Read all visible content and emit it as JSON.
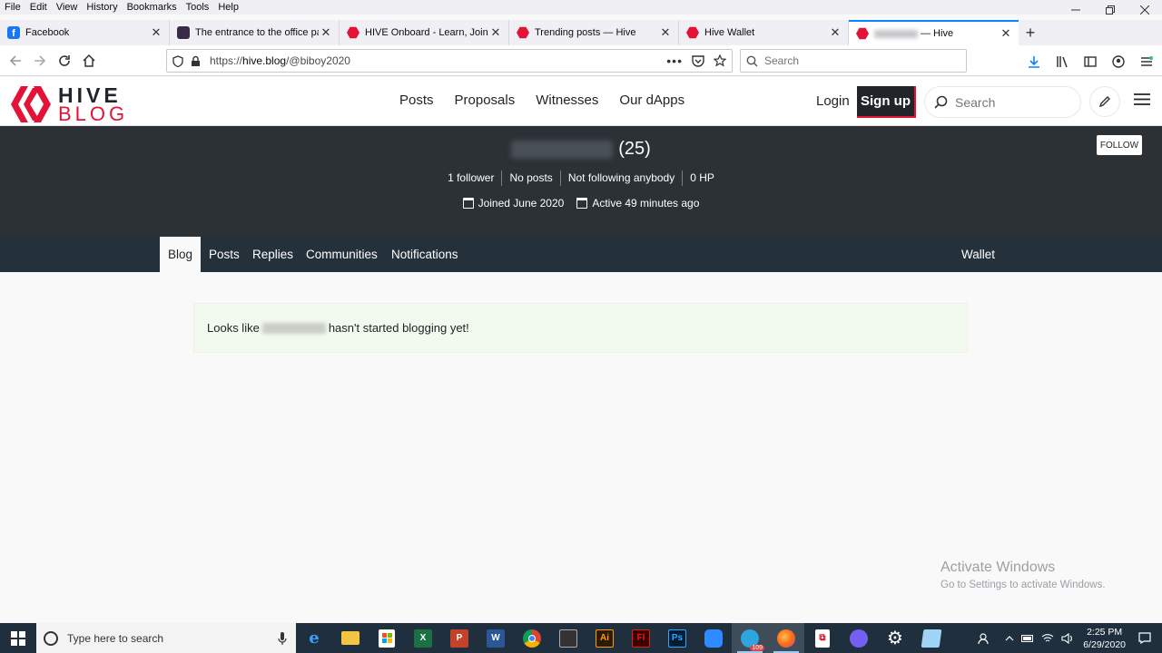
{
  "menu": [
    "File",
    "Edit",
    "View",
    "History",
    "Bookmarks",
    "Tools",
    "Help"
  ],
  "tabs": [
    {
      "title": "Facebook",
      "favicon": "facebook-icon"
    },
    {
      "title": "The entrance to the office party",
      "favicon": "game-icon"
    },
    {
      "title": "HIVE Onboard - Learn, Join and",
      "favicon": "hive-icon"
    },
    {
      "title": "Trending posts — Hive",
      "favicon": "hive-icon"
    },
    {
      "title": "Hive Wallet",
      "favicon": "hive-icon"
    },
    {
      "title": "— Hive",
      "favicon": "hive-icon"
    }
  ],
  "nav": {
    "url_prefix": "https://",
    "url_host": "hive.blog",
    "url_path": "/@biboy2020",
    "search_placeholder": "Search"
  },
  "site": {
    "logo_top": "HIVE",
    "logo_bottom": "BLOG",
    "links": [
      "Posts",
      "Proposals",
      "Witnesses",
      "Our dApps"
    ],
    "login": "Login",
    "signup": "Sign up",
    "search_placeholder": "Search"
  },
  "profile": {
    "reputation": "(25)",
    "stats": [
      "1 follower",
      "No posts",
      "Not following anybody",
      "0 HP"
    ],
    "joined": "Joined June 2020",
    "active": "Active 49 minutes ago",
    "follow": "FOLLOW"
  },
  "profile_tabs": [
    "Blog",
    "Posts",
    "Replies",
    "Communities",
    "Notifications"
  ],
  "wallet_tab": "Wallet",
  "content": {
    "prefix": "Looks like",
    "suffix": "hasn't started blogging yet!"
  },
  "watermark": {
    "line1": "Activate Windows",
    "line2": "Go to Settings to activate Windows."
  },
  "taskbar": {
    "search_placeholder": "Type here to search",
    "time": "2:25 PM",
    "date": "6/29/2020",
    "telegram_badge": "109"
  },
  "colors": {
    "hive_red": "#e31337",
    "dark_banner": "#2c3136",
    "tabs_bg": "#24303a"
  }
}
